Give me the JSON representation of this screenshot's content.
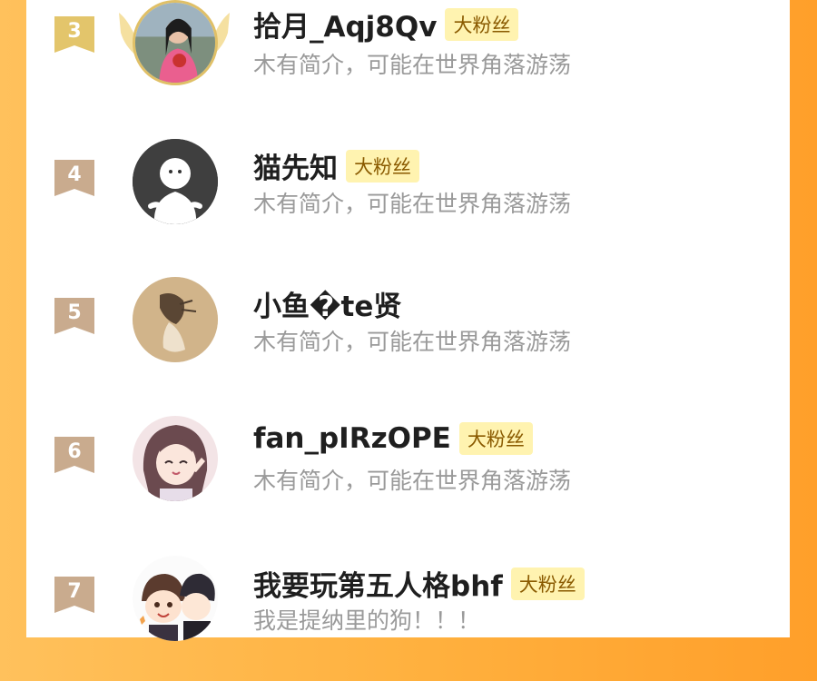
{
  "rows": [
    {
      "rank": "3",
      "name": "拾月_Aqj8Qv",
      "badge": "大粉丝",
      "bio": "木有简介，可能在世界角落游荡",
      "avatar": "photo-girl-with-roses-avatar"
    },
    {
      "rank": "4",
      "name": "猫先知",
      "badge": "大粉丝",
      "bio": "木有简介，可能在世界角落游荡",
      "avatar": "default-ghost-avatar"
    },
    {
      "rank": "5",
      "name": "小鱼�te贤",
      "badge": "",
      "bio": "木有简介，可能在世界角落游荡",
      "avatar": "sepia-art-avatar"
    },
    {
      "rank": "6",
      "name": "fan_pIRzOPE",
      "badge": "大粉丝",
      "bio": "木有简介，可能在世界角落游荡",
      "avatar": "anime-girl-avatar"
    },
    {
      "rank": "7",
      "name": "我要玩第五人格bhf",
      "badge": "大粉丝",
      "bio": "我是提纳里的狗！！！",
      "avatar": "chibi-boys-avatar"
    }
  ],
  "colors": {
    "rank3": "#e3c56b",
    "rank_other": "#c9ab8e",
    "badge_bg": "#fff3b0",
    "bg_left": "#ffc15c",
    "bg_right": "#ff9f2a"
  }
}
